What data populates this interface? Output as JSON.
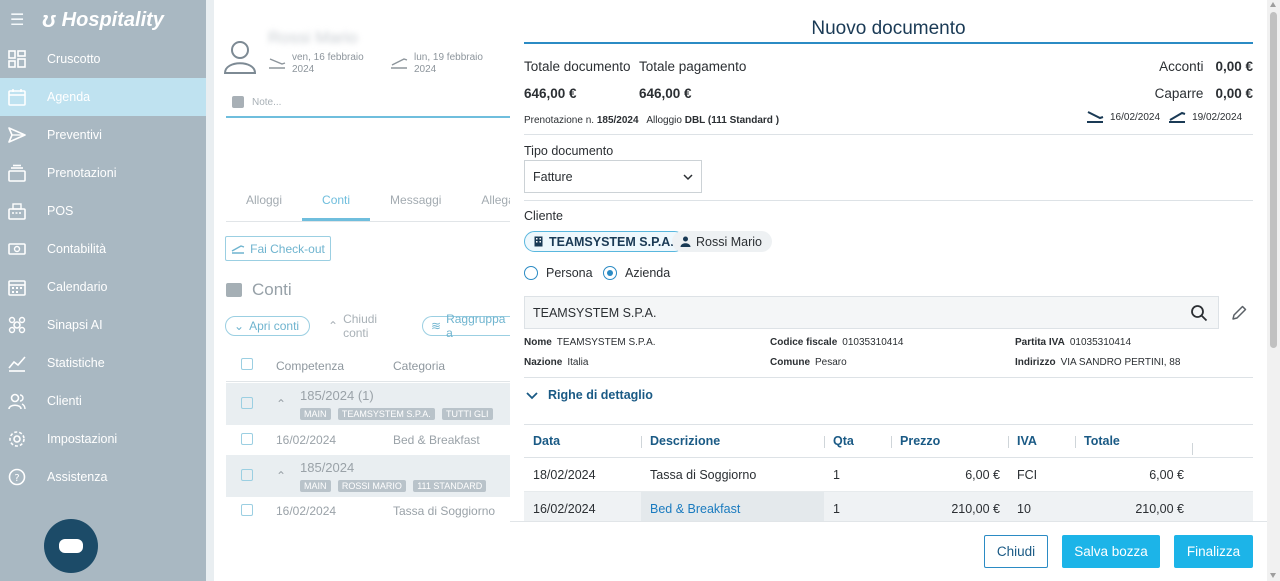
{
  "app": {
    "name": "Hospitality"
  },
  "sidebar": {
    "items": [
      {
        "label": "Cruscotto",
        "icon": "dashboard-icon"
      },
      {
        "label": "Agenda",
        "icon": "calendar-grid-icon",
        "active": true
      },
      {
        "label": "Preventivi",
        "icon": "send-icon"
      },
      {
        "label": "Prenotazioni",
        "icon": "stack-icon"
      },
      {
        "label": "POS",
        "icon": "pos-register-icon"
      },
      {
        "label": "Contabilità",
        "icon": "money-icon"
      },
      {
        "label": "Calendario",
        "icon": "calendar-icon"
      },
      {
        "label": "Sinapsi AI",
        "icon": "ai-icon"
      },
      {
        "label": "Statistiche",
        "icon": "chart-icon"
      },
      {
        "label": "Clienti",
        "icon": "users-icon"
      },
      {
        "label": "Impostazioni",
        "icon": "gear-icon"
      },
      {
        "label": "Assistenza",
        "icon": "help-icon"
      }
    ]
  },
  "background": {
    "guest_name": "Rossi Mario",
    "arrival": {
      "day": "ven, 16 febbraio",
      "year": "2024"
    },
    "departure": {
      "day": "lun, 19 febbraio",
      "year": "2024"
    },
    "notes_placeholder": "Note...",
    "tabs": [
      "Alloggi",
      "Conti",
      "Messaggi",
      "Allega"
    ],
    "checkout_label": "Fai Check-out",
    "conti_title": "Conti",
    "apri_conti": "Apri conti",
    "chiudi_conti": "Chiudi conti",
    "raggruppa": "Raggruppa a",
    "col_competenza": "Competenza",
    "col_categoria": "Categoria",
    "group1": {
      "title": "185/2024 (1)",
      "tags": [
        "MAIN",
        "TEAMSYSTEM S.P.A.",
        "TUTTI GLI"
      ]
    },
    "row1": {
      "date": "16/02/2024",
      "category": "Bed & Breakfast"
    },
    "group2": {
      "title": "185/2024",
      "tags": [
        "MAIN",
        "ROSSI MARIO",
        "111 STANDARD"
      ]
    },
    "row2": {
      "date": "16/02/2024",
      "category": "Tassa di Soggiorno"
    }
  },
  "dialog": {
    "title": "Nuovo documento",
    "totale_documento_label": "Totale documento",
    "totale_documento_value": "646,00 €",
    "totale_pagamento_label": "Totale pagamento",
    "totale_pagamento_value": "646,00 €",
    "acconti_label": "Acconti",
    "acconti_value": "0,00 €",
    "caparre_label": "Caparre",
    "caparre_value": "0,00 €",
    "prenotazione_label": "Prenotazione n.",
    "prenotazione_value": "185/2024",
    "alloggio_label": "Alloggio",
    "alloggio_value": "DBL (111 Standard )",
    "arrival_date": "16/02/2024",
    "departure_date": "19/02/2024",
    "tipo_documento_label": "Tipo documento",
    "tipo_documento_value": "Fatture",
    "cliente_label": "Cliente",
    "chip_company": "TEAMSYSTEM S.P.A.",
    "chip_person": "Rossi Mario",
    "radio_persona": "Persona",
    "radio_azienda": "Azienda",
    "radio_selected": "Azienda",
    "search_value": "TEAMSYSTEM S.P.A.",
    "nome_label": "Nome",
    "nome_value": "TEAMSYSTEM S.P.A.",
    "cf_label": "Codice fiscale",
    "cf_value": "01035310414",
    "piva_label": "Partita IVA",
    "piva_value": "01035310414",
    "nazione_label": "Nazione",
    "nazione_value": "Italia",
    "comune_label": "Comune",
    "comune_value": "Pesaro",
    "indirizzo_label": "Indirizzo",
    "indirizzo_value": "VIA SANDRO PERTINI, 88",
    "righe_label": "Righe di dettaglio",
    "table": {
      "headers": [
        "Data",
        "Descrizione",
        "Qta",
        "Prezzo",
        "IVA",
        "Totale"
      ],
      "rows": [
        {
          "data": "18/02/2024",
          "descrizione": "Tassa di Soggiorno",
          "qta": "1",
          "prezzo": "6,00 €",
          "iva": "FCI",
          "totale": "6,00 €"
        },
        {
          "data": "16/02/2024",
          "descrizione": "Bed & Breakfast",
          "qta": "1",
          "prezzo": "210,00 €",
          "iva": "10",
          "totale": "210,00 €"
        }
      ]
    },
    "btn_chiudi": "Chiudi",
    "btn_salva": "Salva bozza",
    "btn_finalizza": "Finalizza"
  },
  "colors": {
    "accent": "#1cb4e8",
    "primary_dark": "#1a3a55",
    "sidebar": "#a9b8c2",
    "link": "#1a7bbf"
  }
}
